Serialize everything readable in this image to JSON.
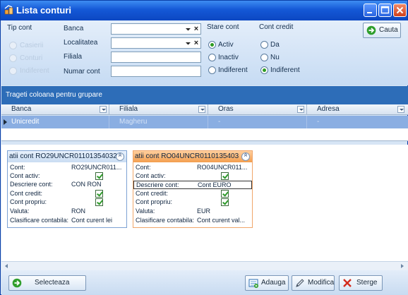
{
  "window": {
    "title": "Lista conturi"
  },
  "filters": {
    "tip_cont_label": "Tip cont",
    "tip_options": [
      {
        "label": "Casierii"
      },
      {
        "label": "Conturi"
      },
      {
        "label": "Indiferent"
      }
    ],
    "banca_label": "Banca",
    "localitatea_label": "Localitatea",
    "filiala_label": "Filiala",
    "numar_cont_label": "Numar cont",
    "stare_cont_label": "Stare cont",
    "stare_options": [
      {
        "label": "Activ",
        "checked": true
      },
      {
        "label": "Inactiv",
        "checked": false
      },
      {
        "label": "Indiferent",
        "checked": false
      }
    ],
    "cont_credit_label": "Cont credit",
    "credit_options": [
      {
        "label": "Da",
        "checked": false
      },
      {
        "label": "Nu",
        "checked": false
      },
      {
        "label": "Indiferent",
        "checked": true
      }
    ],
    "search_button": "Cauta"
  },
  "group_bar": {
    "text": "Trageti coloana pentru grupare"
  },
  "grid": {
    "columns": [
      "Banca",
      "Filiala",
      "Oras",
      "Adresa"
    ],
    "row": {
      "banca": "Unicredit",
      "filiala": "Magheru",
      "oras": "-",
      "adresa": "-"
    }
  },
  "cards": [
    {
      "header": "atii cont RO29UNCR01101354032",
      "cont": "RO29UNCR011...",
      "valuta": "RON",
      "descriere": "CON RON",
      "clasificare": "Cont curent lei"
    },
    {
      "header": "atii cont RO04UNCR0110135403",
      "cont": "RO04UNCR011...",
      "valuta": "EUR",
      "descriere": "Cont EURO",
      "clasificare": "Cont curent val..."
    }
  ],
  "field_labels": {
    "cont": "Cont:",
    "cont_activ": "Cont activ:",
    "descriere": "Descriere cont:",
    "cont_credit": "Cont credit:",
    "cont_propriu": "Cont propriu:",
    "valuta": "Valuta:",
    "clasificare": "Clasificare contabila:"
  },
  "buttons": {
    "selecteaza": "Selecteaza",
    "adauga": "Adauga",
    "modifica": "Modifica",
    "sterge": "Sterge"
  }
}
